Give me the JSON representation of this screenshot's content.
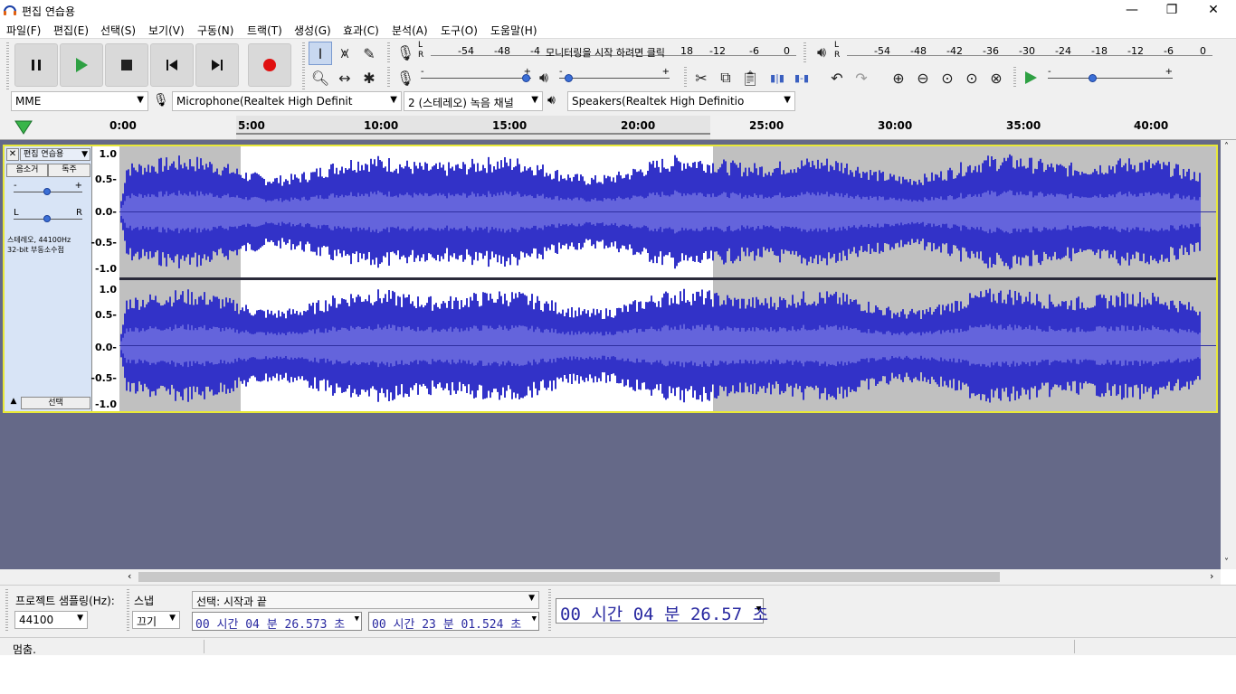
{
  "window": {
    "title": "편집 연습용"
  },
  "menu": [
    "파일(F)",
    "편집(E)",
    "선택(S)",
    "보기(V)",
    "구동(N)",
    "트랙(T)",
    "생성(G)",
    "효과(C)",
    "분석(A)",
    "도구(O)",
    "도움말(H)"
  ],
  "record_meter": {
    "lr_top": "L",
    "lr_bottom": "R",
    "ticks": [
      "-54",
      "-48",
      "-4",
      "18",
      "-12",
      "-6",
      "0"
    ],
    "hint": "모니터링을 시작 하려면 클릭"
  },
  "play_meter": {
    "lr_top": "L",
    "lr_bottom": "R",
    "ticks": [
      "-54",
      "-48",
      "-42",
      "-36",
      "-30",
      "-24",
      "-18",
      "-12",
      "-6",
      "0"
    ]
  },
  "sliders": {
    "minus": "-",
    "plus": "+",
    "rec_level": 1.0,
    "play_level": 0.05,
    "speed_level": 0.35
  },
  "devices": {
    "host": "MME",
    "input": "Microphone(Realtek High Definit",
    "channels": "2 (스테레오) 녹음 채널",
    "output": "Speakers(Realtek High Definitio"
  },
  "ruler": {
    "ticks": [
      "0:00",
      "5:00",
      "10:00",
      "15:00",
      "20:00",
      "25:00",
      "30:00",
      "35:00",
      "40:00"
    ]
  },
  "track": {
    "name": "편집 연습용",
    "mute": "음소거",
    "solo": "독주",
    "gain_minus": "-",
    "gain_plus": "+",
    "pan_left": "L",
    "pan_right": "R",
    "info_line1": "스테레오, 44100Hz",
    "info_line2": "32-bit 부동소수점",
    "select": "선택",
    "vscale": [
      "1.0",
      "0.5-",
      "0.0-",
      "-0.5-",
      "-1.0"
    ]
  },
  "bottom": {
    "rate_label": "프로젝트 샘플링(Hz):",
    "rate_value": "44100",
    "snap_label": "스냅",
    "snap_value": "끄기",
    "selection_mode": "선택: 시작과 끝",
    "sel_start": "00 시간 04 분 26.573 초",
    "sel_end": "00 시간 23 분 01.524 초",
    "audio_pos": "00 시간 04 분 26.57 초"
  },
  "status": {
    "text": "멈춤."
  },
  "colors": {
    "wave": "#3232c8",
    "wave_rms": "#6464dc",
    "track_bg": "#656988",
    "selection_bg": "#ffffff",
    "unselected_bg": "#c0c0c0",
    "record": "#e01010",
    "play": "#2ea043"
  }
}
